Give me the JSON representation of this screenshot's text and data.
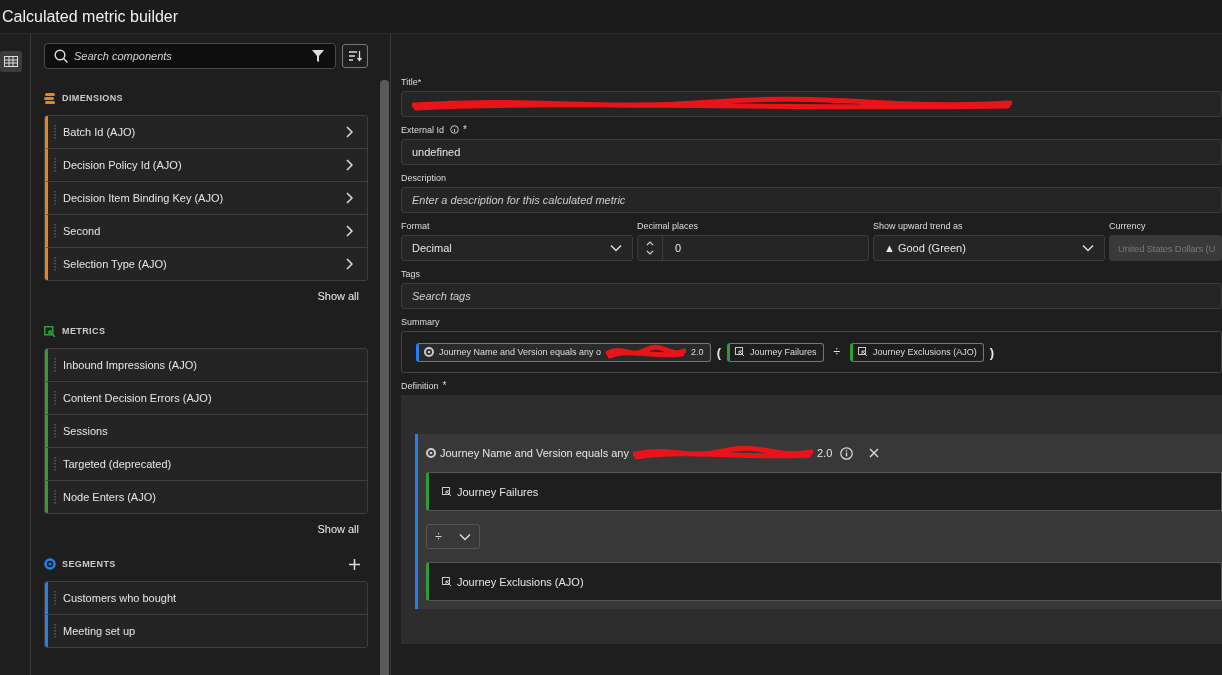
{
  "window": {
    "title": "Calculated metric builder"
  },
  "rail": {
    "selected": true
  },
  "panel": {
    "search": {
      "placeholder": "Search components"
    },
    "sections": [
      {
        "kind": "dimension",
        "heading": "DIMENSIONS",
        "color": "#e68619",
        "items": [
          {
            "label": "Batch Id (AJO)"
          },
          {
            "label": "Decision Policy Id (AJO)"
          },
          {
            "label": "Decision Item Binding Key (AJO)"
          },
          {
            "label": "Second"
          },
          {
            "label": "Selection Type (AJO)"
          }
        ],
        "show_all": "Show all"
      },
      {
        "kind": "metric",
        "heading": "METRICS",
        "color": "#2d9d3a",
        "items": [
          {
            "label": "Inbound Impressions (AJO)"
          },
          {
            "label": "Content Decision Errors (AJO)"
          },
          {
            "label": "Sessions"
          },
          {
            "label": "Targeted (deprecated)"
          },
          {
            "label": "Node Enters (AJO)"
          }
        ],
        "show_all": "Show all"
      },
      {
        "kind": "segment",
        "heading": "SEGMENTS",
        "color": "#2680eb",
        "add": true,
        "items": [
          {
            "label": "Customers who bought"
          },
          {
            "label": "Meeting set up"
          }
        ]
      }
    ]
  },
  "form": {
    "title": {
      "label": "Title*",
      "redacted": true
    },
    "external_id": {
      "label": "External Id",
      "required": "*",
      "value": "undefined"
    },
    "description": {
      "label": "Description",
      "placeholder": "Enter a description for this calculated metric"
    },
    "format": {
      "label": "Format",
      "value": "Decimal"
    },
    "decimal_places": {
      "label": "Decimal places",
      "value": "0"
    },
    "trend": {
      "label": "Show upward trend as",
      "value": "▲ Good (Green)"
    },
    "currency": {
      "label": "Currency",
      "value": "United States Dollars (U",
      "disabled": true
    },
    "tags": {
      "label": "Tags",
      "placeholder": "Search tags"
    },
    "summary": {
      "label": "Summary",
      "items": [
        {
          "kind": "segment",
          "text": "Journey Name and Version equals any o",
          "redacted": true,
          "tail": "2.0"
        },
        {
          "kind": "paren",
          "text": "("
        },
        {
          "kind": "metric",
          "text": "Journey Failures"
        },
        {
          "kind": "operator",
          "text": "÷"
        },
        {
          "kind": "metric",
          "text": "Journey Exclusions (AJO)"
        },
        {
          "kind": "paren",
          "text": ")"
        }
      ]
    },
    "definition": {
      "label": "Definition",
      "required": "*",
      "container": {
        "text": "Journey Name and Version equals any",
        "redacted": true,
        "tail": "2.0",
        "first": "Journey Failures",
        "operator": "÷",
        "second": "Journey Exclusions (AJO)"
      }
    }
  }
}
